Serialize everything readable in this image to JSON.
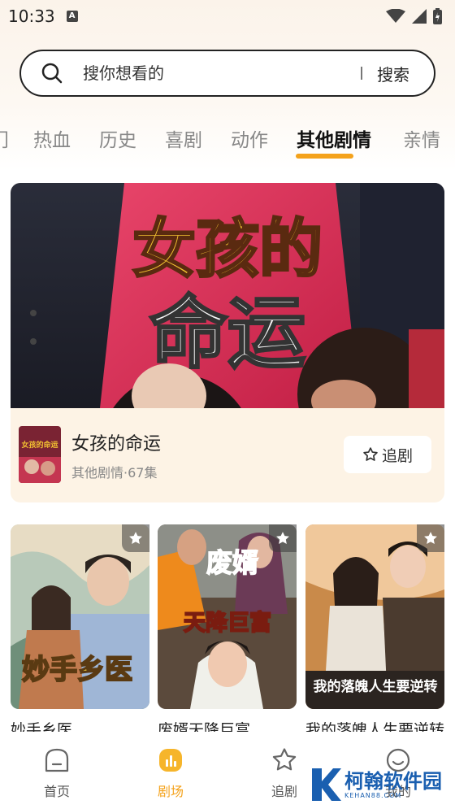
{
  "status_bar": {
    "time": "10:33",
    "notification_letter": "A"
  },
  "search": {
    "placeholder": "搜你想看的",
    "button_label": "搜索"
  },
  "tabs": [
    {
      "label": "门"
    },
    {
      "label": "热血"
    },
    {
      "label": "历史"
    },
    {
      "label": "喜剧"
    },
    {
      "label": "动作"
    },
    {
      "label": "其他剧情",
      "active": true
    },
    {
      "label": "亲情"
    }
  ],
  "featured": {
    "banner_text_1": "女孩的",
    "banner_text_2": "命运",
    "title": "女孩的命运",
    "meta": "其他剧情·67集",
    "follow_label": "追剧",
    "thumb_text": "女孩的命运"
  },
  "dramas": [
    {
      "title": "妙手乡医",
      "cover_text": "妙手乡医"
    },
    {
      "title": "废婿天降巨富",
      "cover_text_1": "废婿",
      "cover_text_2": "天降巨富"
    },
    {
      "title": "我的落魄人生要逆转",
      "cover_text": "我的落魄人生要逆转"
    }
  ],
  "nav": [
    {
      "label": "首页",
      "icon": "home-icon"
    },
    {
      "label": "剧场",
      "icon": "theater-icon",
      "active": true
    },
    {
      "label": "追剧",
      "icon": "star-icon"
    },
    {
      "label": "我的",
      "icon": "profile-icon"
    }
  ],
  "watermark": {
    "text": "柯翰软件园",
    "sub": "KEHAN88.COM"
  },
  "colors": {
    "accent": "#f4a21b",
    "card_bg": "#fdf3e5"
  }
}
